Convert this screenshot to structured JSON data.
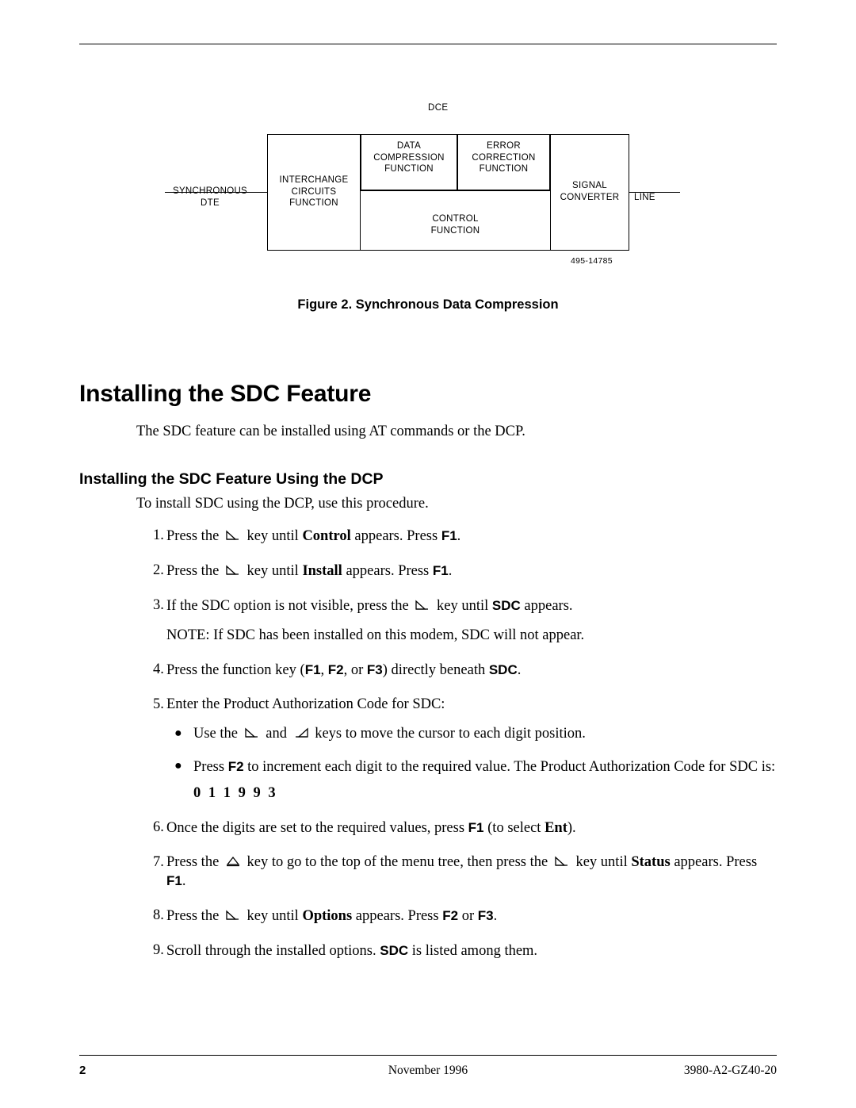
{
  "figure": {
    "dce_label": "DCE",
    "dte_label": "SYNCHRONOUS\nDTE",
    "interchange_label": "INTERCHANGE\nCIRCUITS\nFUNCTION",
    "data_compression_label": "DATA\nCOMPRESSION\nFUNCTION",
    "error_correction_label": "ERROR\nCORRECTION\nFUNCTION",
    "control_label": "CONTROL\nFUNCTION",
    "signal_converter_label": "SIGNAL\nCONVERTER",
    "line_label": "LINE",
    "drawing_number": "495-14785",
    "caption": "Figure 2.  Synchronous Data Compression"
  },
  "headings": {
    "h1": "Installing the SDC Feature",
    "h2": "Installing the SDC Feature Using the DCP"
  },
  "paragraphs": {
    "intro": "The SDC feature can be installed using AT commands or the DCP.",
    "dcp_intro": "To install SDC using the DCP, use this procedure."
  },
  "steps": [
    {
      "num": "1.",
      "pre": "Press the",
      "key": "right-arrow-key-icon",
      "mid": "key until",
      "bold1": "Control",
      "mid2": "appears. Press",
      "bold2": "F1",
      "post": "."
    },
    {
      "num": "2.",
      "pre": "Press the",
      "key": "right-arrow-key-icon",
      "mid": "key until",
      "bold1": "Install",
      "mid2": "appears. Press",
      "bold2": "F1",
      "post": "."
    },
    {
      "num": "3.",
      "pre": "If the SDC option is not visible, press the",
      "key": "right-arrow-key-icon",
      "mid": "key until",
      "bold1": "SDC",
      "mid2": "appears.",
      "note": "NOTE: If SDC has been installed on this modem, SDC will not appear."
    },
    {
      "num": "4.",
      "pre": "Press the function key (",
      "bold1": "F1",
      "sep1": ", ",
      "bold2": "F2",
      "sep2": ", or ",
      "bold3": "F3",
      "mid": ") directly beneath",
      "bold4": "SDC",
      "post": "."
    },
    {
      "num": "5.",
      "text": "Enter the Product Authorization Code for SDC:",
      "bullets": [
        {
          "pre": "Use the",
          "key1": "right-arrow-key-icon",
          "mid": "and",
          "key2": "left-arrow-key-icon",
          "post": "keys to move the cursor to each digit position."
        },
        {
          "pre": "Press",
          "bold1": "F2",
          "post": "to increment each digit to the required value. The Product Authorization Code for SDC is:",
          "code": "0 1 1 9 9 3"
        }
      ]
    },
    {
      "num": "6.",
      "pre": "Once the digits are set to the required values, press",
      "bold1": "F1",
      "mid": "(to select",
      "bold2": "Ent",
      "post": ")."
    },
    {
      "num": "7.",
      "pre": "Press the",
      "key": "up-arrow-key-icon",
      "mid": "key to go to the top of the menu tree, then press the",
      "key2": "right-arrow-key-icon",
      "mid2": "key until",
      "bold1": "Status",
      "mid3": "appears. Press",
      "bold2": "F1",
      "post": "."
    },
    {
      "num": "8.",
      "pre": "Press the",
      "key": "right-arrow-key-icon",
      "mid": "key until",
      "bold1": "Options",
      "mid2": "appears. Press",
      "bold2": "F2",
      "mid3": "or",
      "bold3": "F3",
      "post": "."
    },
    {
      "num": "9.",
      "pre": "Scroll through the installed options.",
      "bold1": "SDC",
      "post": "is listed among them."
    }
  ],
  "footer": {
    "page_number": "2",
    "date": "November 1996",
    "doc_id": "3980-A2-GZ40-20"
  }
}
